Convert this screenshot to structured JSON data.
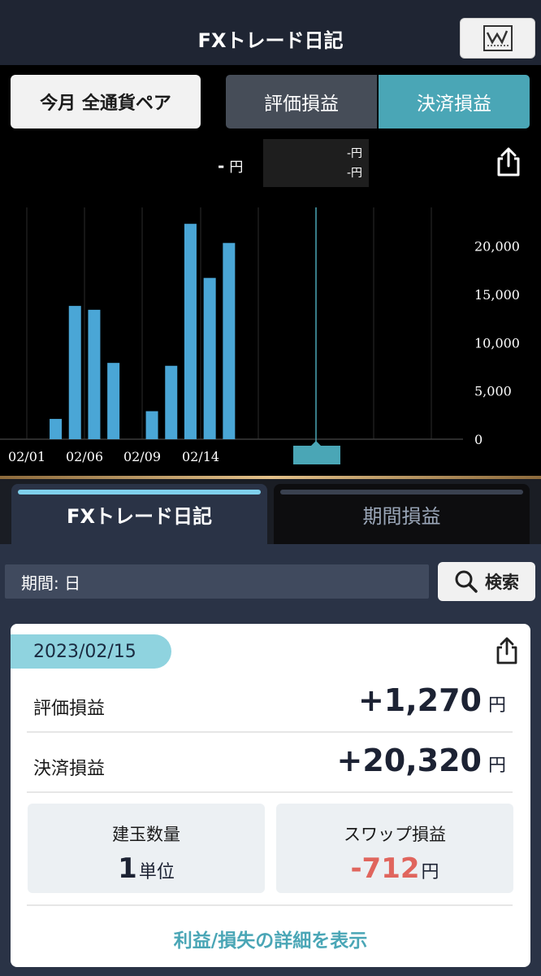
{
  "header": {
    "title": "FXトレード日記"
  },
  "controls": {
    "period_button": "今月 全通貨ペア",
    "segment": [
      "評価損益",
      "決済損益"
    ],
    "segment_selected": 1
  },
  "summary": {
    "main_value": "-",
    "main_unit": "円",
    "line1": "-円",
    "line2": "-円"
  },
  "chart_data": {
    "type": "bar",
    "x": [
      "02/01",
      "02/02",
      "02/03",
      "02/06",
      "02/07",
      "02/08",
      "02/09",
      "02/10",
      "02/13",
      "02/14",
      "02/15"
    ],
    "x_tick_labels": [
      "02/01",
      "02/06",
      "02/09",
      "02/14"
    ],
    "values": [
      0,
      2100,
      13800,
      13400,
      7900,
      0,
      2900,
      7600,
      22300,
      16700,
      20320
    ],
    "ylim": [
      0,
      24000
    ],
    "y_ticks": [
      0,
      5000,
      10000,
      15000,
      20000
    ],
    "y_tick_labels": [
      "0",
      "5,000",
      "10,000",
      "15,000",
      "20,000"
    ],
    "grid": true,
    "color": "#4aa6d6"
  },
  "tabs": [
    {
      "label": "FXトレード日記",
      "active": true
    },
    {
      "label": "期間損益",
      "active": false
    }
  ],
  "filter": {
    "period_label": "期間: 日",
    "search_label": "検索"
  },
  "card": {
    "date": "2023/02/15",
    "rows": [
      {
        "label": "評価損益",
        "value": "+1,270",
        "unit": "円"
      },
      {
        "label": "決済損益",
        "value": "+20,320",
        "unit": "円"
      }
    ],
    "tiles": [
      {
        "label": "建玉数量",
        "value": "1",
        "unit": "単位",
        "negative": false
      },
      {
        "label": "スワップ損益",
        "value": "-712",
        "unit": "円",
        "negative": true
      }
    ],
    "details_link": "利益/損失の詳細を表示"
  },
  "colors": {
    "accent": "#4aa6b6",
    "header_bg": "#1f2533",
    "panel_bg": "#2a3346",
    "negative": "#e0655d"
  }
}
